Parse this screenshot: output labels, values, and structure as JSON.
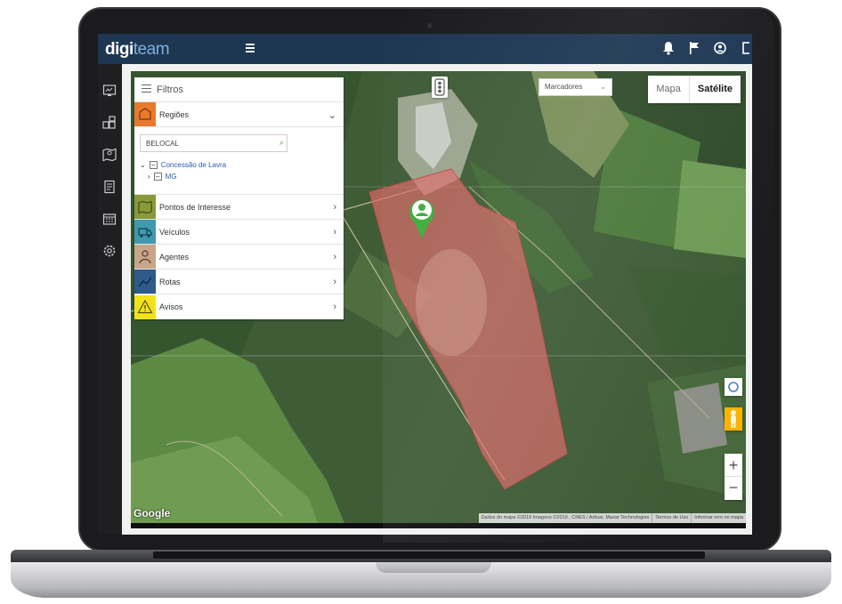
{
  "app": {
    "logo_bold": "digi",
    "logo_light": "team"
  },
  "topbar": {
    "icons": [
      "bell-icon",
      "flag-icon",
      "user-icon",
      "window-icon"
    ]
  },
  "leftbar": {
    "icons": [
      "dashboard-icon",
      "modules-icon",
      "map-pin-icon",
      "report-icon",
      "calendar-icon",
      "settings-icon"
    ]
  },
  "panel": {
    "title": "Filtros",
    "regions": {
      "label": "Regiões",
      "search_value": "BELOCAL",
      "tree": [
        {
          "label": "Concessão de Lavra",
          "expanded": true
        },
        {
          "label": "MG",
          "expanded": false
        }
      ]
    },
    "items": [
      {
        "label": "Pontos de Interesse",
        "icon": "map-icon"
      },
      {
        "label": "Veículos",
        "icon": "truck-icon"
      },
      {
        "label": "Agentes",
        "icon": "agent-icon"
      },
      {
        "label": "Rotas",
        "icon": "route-icon"
      },
      {
        "label": "Avisos",
        "icon": "warning-icon"
      }
    ]
  },
  "map": {
    "markers_select": "Marcadores",
    "map_type": {
      "map": "Mapa",
      "satellite": "Satélite",
      "selected": "satellite"
    },
    "zoom_in": "+",
    "zoom_out": "−",
    "google": "Google",
    "attribution": [
      "Dados do mapa ©2019 Imagens ©2019 , CNES / Airbus, Maxar Technologies",
      "Termos de Uso",
      "Informar erro no mapa"
    ],
    "colors": {
      "region_fill": "#e06a6a",
      "marker": "#3cae3a"
    }
  },
  "colors": {
    "topbar": "#1d3652",
    "accent": "#7fb1dc"
  }
}
